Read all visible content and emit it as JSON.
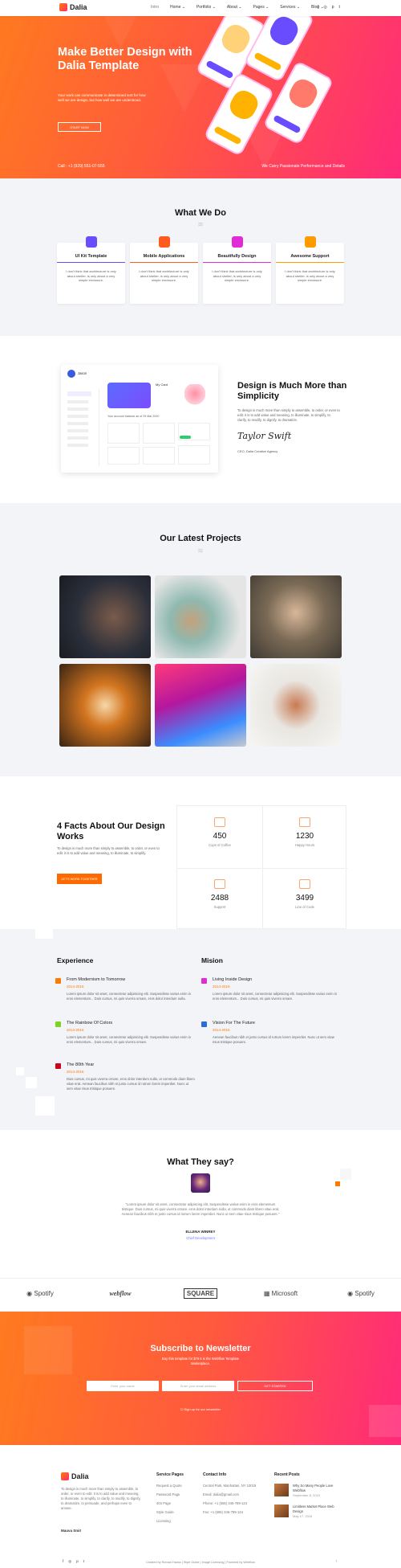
{
  "nav": {
    "brand": "Dalia",
    "items": [
      "Intro",
      "Home ⌄",
      "Portfolio ⌄",
      "About ⌄",
      "Pages ⌄",
      "Services ⌄",
      "Blog ⌄"
    ],
    "socials": [
      "f",
      "◎",
      "p",
      "t"
    ]
  },
  "hero": {
    "title": "Make Better Design with Dalia Template",
    "lead": "Your work can communicate in determined sort for how well we are design, but how well we are understood.",
    "button": "START NOW",
    "call": "Call : +1 (929) 551-07-555",
    "tagline": "We Carry Passionate Performance and Details"
  },
  "what": {
    "title": "What We Do",
    "cards": [
      {
        "title": "UI Kit Template",
        "desc": "I don't think that architecture is only about shelter, is only about a very simple enclosure.",
        "color": "#6a4cff"
      },
      {
        "title": "Mobile Applications",
        "desc": "I don't think that architecture is only about shelter, is only about a very simple enclosure.",
        "color": "#ff5a1f"
      },
      {
        "title": "Beautifully Design",
        "desc": "I don't think that architecture is only about shelter, is only about a very simple enclosure.",
        "color": "#e12bd6"
      },
      {
        "title": "Awesome Support",
        "desc": "I don't think that architecture is only about shelter, is only about a very simple enclosure.",
        "color": "#ff9a00"
      }
    ]
  },
  "design": {
    "title": "Design is Much More than Simplicity",
    "text": "To design is much more than simply to assemble, to order, or even to edit: it is to add value and meaning, to illuminate, to simplify, to clarify, to modify, to dignify, to dramatize.",
    "signature": "Taylor Swift",
    "ceo": "CEO, Dalia Creative Agency",
    "dash_user": "Jason",
    "dash_card": "My Card",
    "dash_note": "Your account balance as of 29 Mar 2020"
  },
  "projects": {
    "title": "Our Latest Projects"
  },
  "facts": {
    "title": "4 Facts About Our Design Works",
    "text": "To design is much more than simply to assemble, to order, or even to edit: it is to add value and meaning, to illuminate, to simplify.",
    "button": "LET'S WORK TOGETHER",
    "items": [
      {
        "n": "450",
        "l": "Cups of Coffee"
      },
      {
        "n": "1230",
        "l": "Happy Hours"
      },
      {
        "n": "2488",
        "l": "Support"
      },
      {
        "n": "3499",
        "l": "Line of Code"
      }
    ]
  },
  "experience": {
    "title": "Experience",
    "items": [
      {
        "t": "From Modernism to Tomorrow",
        "y": "2014-2015",
        "d": "Lorem ipsum dolor sit amet, consectetur adipisicing elit. Suspendisse varius enim in eros elementum... Duis cursus, mi quis viverra ornare, eros dolor interdum nulla.",
        "c": "#ff7a00"
      },
      {
        "t": "The Rainbow Of Colors",
        "y": "2014-2015",
        "d": "Lorem ipsum dolor sit amet, consectetur adipisicing elit. Suspendisse varius enim in eros elementum... Duis cursus, mi quis viverra ornare.",
        "c": "#7ed321"
      },
      {
        "t": "The 80th Year",
        "y": "2014-2015",
        "d": "Duis cursus, mi quis viverra ornare, eros dolor interdum nulla, ut commodo diam libero vitae erat. Aenean faucibus nibh et justo cursus id rutrum lorem imperdiet. Nunc ut sem vitae risus tristique posuere.",
        "c": "#d0021b"
      }
    ]
  },
  "mission": {
    "title": "Mision",
    "items": [
      {
        "t": "Living Inside Design",
        "y": "2014-2015",
        "d": "Lorem ipsum dolor sit amet, consectetur adipisicing elit. Suspendisse varius enim in eros elementum... Duis cursus, mi quis viverra ornare.",
        "c": "#e12bd6"
      },
      {
        "t": "Vision For The Future",
        "y": "2014-2015",
        "d": "Aenean faucibus nibh et justo cursus id rutrum lorem imperdiet. Nunc ut sem vitae risus tristique posuere.",
        "c": "#2a6cd8"
      }
    ]
  },
  "testimonial": {
    "title": "What They say?",
    "quote": "\"Lorem ipsum dolor sit amet, consectetur adipiscing elit. Suspendisse varius enim in eros elementum tristique. Duis cursus, mi quis viverra ornare, eros dolor interdum nulla, ut commodo diam libero vitae erat. Aenean faucibus nibh et justo cursus id rutrum lorem imperdiet. Nunc ut sem vitae risus tristique posuere.\"",
    "name": "ELLENA WINREY",
    "role": "Chief Development"
  },
  "brands": [
    "Spotify",
    "webflow",
    "SQUARE",
    "Microsoft",
    "Spotify"
  ],
  "newsletter": {
    "title": "Subscribe to Newsletter",
    "sub": "Buy this template for $79 it is the Webflow Template Marketplace.",
    "name_ph": "Enter your name",
    "email_ph": "Enter your email address",
    "button": "GET STARTED",
    "signup": "Sign up for our newsletter"
  },
  "footer": {
    "brand": "Dalia",
    "about": "To design is much more than simply to assemble, to order, or even to edit: it is to add value and meaning, to illuminate, to simplify, to clarify, to modify, to dignify, to dramatize, to persuade, and perhaps even to amuse.",
    "name": "Mauva Smit",
    "service_title": "Service Pages",
    "services": [
      "Request a Quote",
      "Password Page",
      "404 Page",
      "Style Guide",
      "Licensing"
    ],
    "contact_title": "Contact Info",
    "contact": [
      "Central Park, Manhattan, NY 10019",
      "Email: dalia@gmail.com",
      "Phone: +1 (555) 346-789-124",
      "Fax: +1 (555) 346-789-124"
    ],
    "recent_title": "Recent Posts",
    "posts": [
      {
        "t": "Why So Many People Love Webflow",
        "d": "September 8, 2019"
      },
      {
        "t": "Limitless Market Place Web Design",
        "d": "May 17, 2018"
      }
    ],
    "copyright": "Created by Roman Haoss | Style Guide | Image Licensing | Powered by Webflow"
  }
}
